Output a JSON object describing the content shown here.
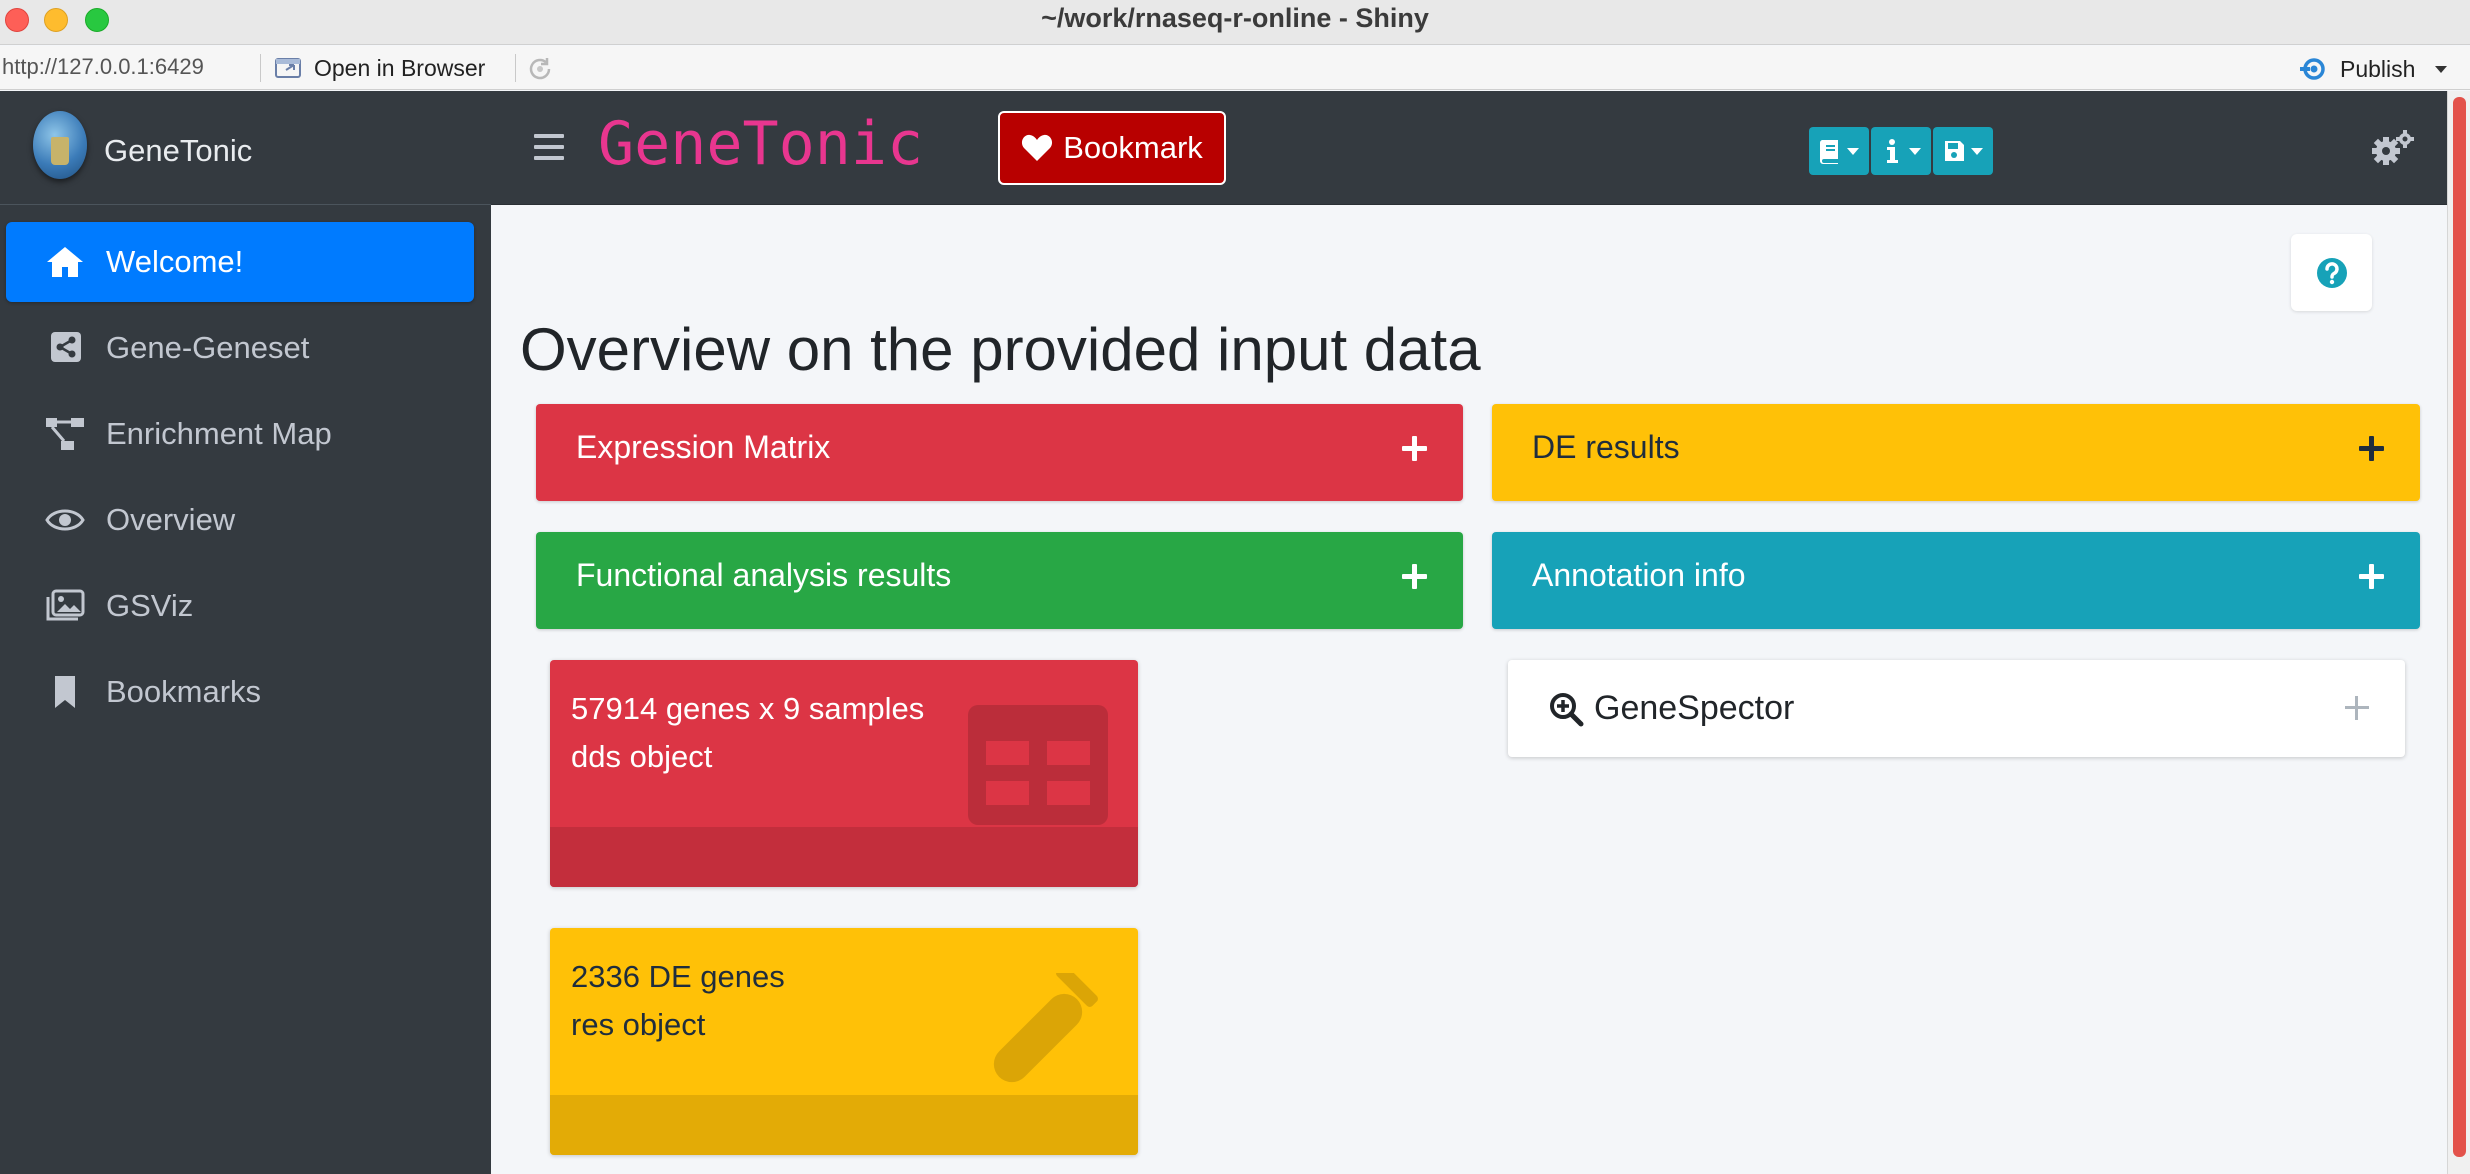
{
  "window": {
    "title": "~/work/rnaseq-r-online - Shiny"
  },
  "addressbar": {
    "url": "http://127.0.0.1:6429",
    "open_in_browser": "Open in Browser",
    "publish": "Publish"
  },
  "sidebar": {
    "brand": "GeneTonic",
    "items": [
      {
        "label": "Welcome!",
        "icon": "home-icon",
        "active": true
      },
      {
        "label": "Gene-Geneset",
        "icon": "share-square-icon",
        "active": false
      },
      {
        "label": "Enrichment Map",
        "icon": "project-diagram-icon",
        "active": false
      },
      {
        "label": "Overview",
        "icon": "eye-icon",
        "active": false
      },
      {
        "label": "GSViz",
        "icon": "images-icon",
        "active": false
      },
      {
        "label": "Bookmarks",
        "icon": "bookmark-icon",
        "active": false
      }
    ]
  },
  "navbar": {
    "app_title": "GeneTonic",
    "bookmark_label": "Bookmark",
    "tools": [
      "book-icon",
      "info-icon",
      "save-icon"
    ]
  },
  "main": {
    "page_title": "Overview on the provided input data",
    "cards": {
      "expression_matrix": "Expression Matrix",
      "de_results": "DE results",
      "functional_analysis": "Functional analysis results",
      "annotation_info": "Annotation info"
    },
    "genespector": "GeneSpector",
    "boxes": {
      "dds_line1": "57914 genes x 9 samples",
      "dds_line2": "dds object",
      "res_line1": "2336 DE genes",
      "res_line2": "res object"
    }
  },
  "colors": {
    "sidebar_bg": "#343a40",
    "active_blue": "#007bff",
    "danger": "#dc3545",
    "warning": "#ffc107",
    "success": "#28a745",
    "info": "#17a2b8",
    "title_pink": "#e8368f",
    "bookmark_red": "#b80000"
  }
}
